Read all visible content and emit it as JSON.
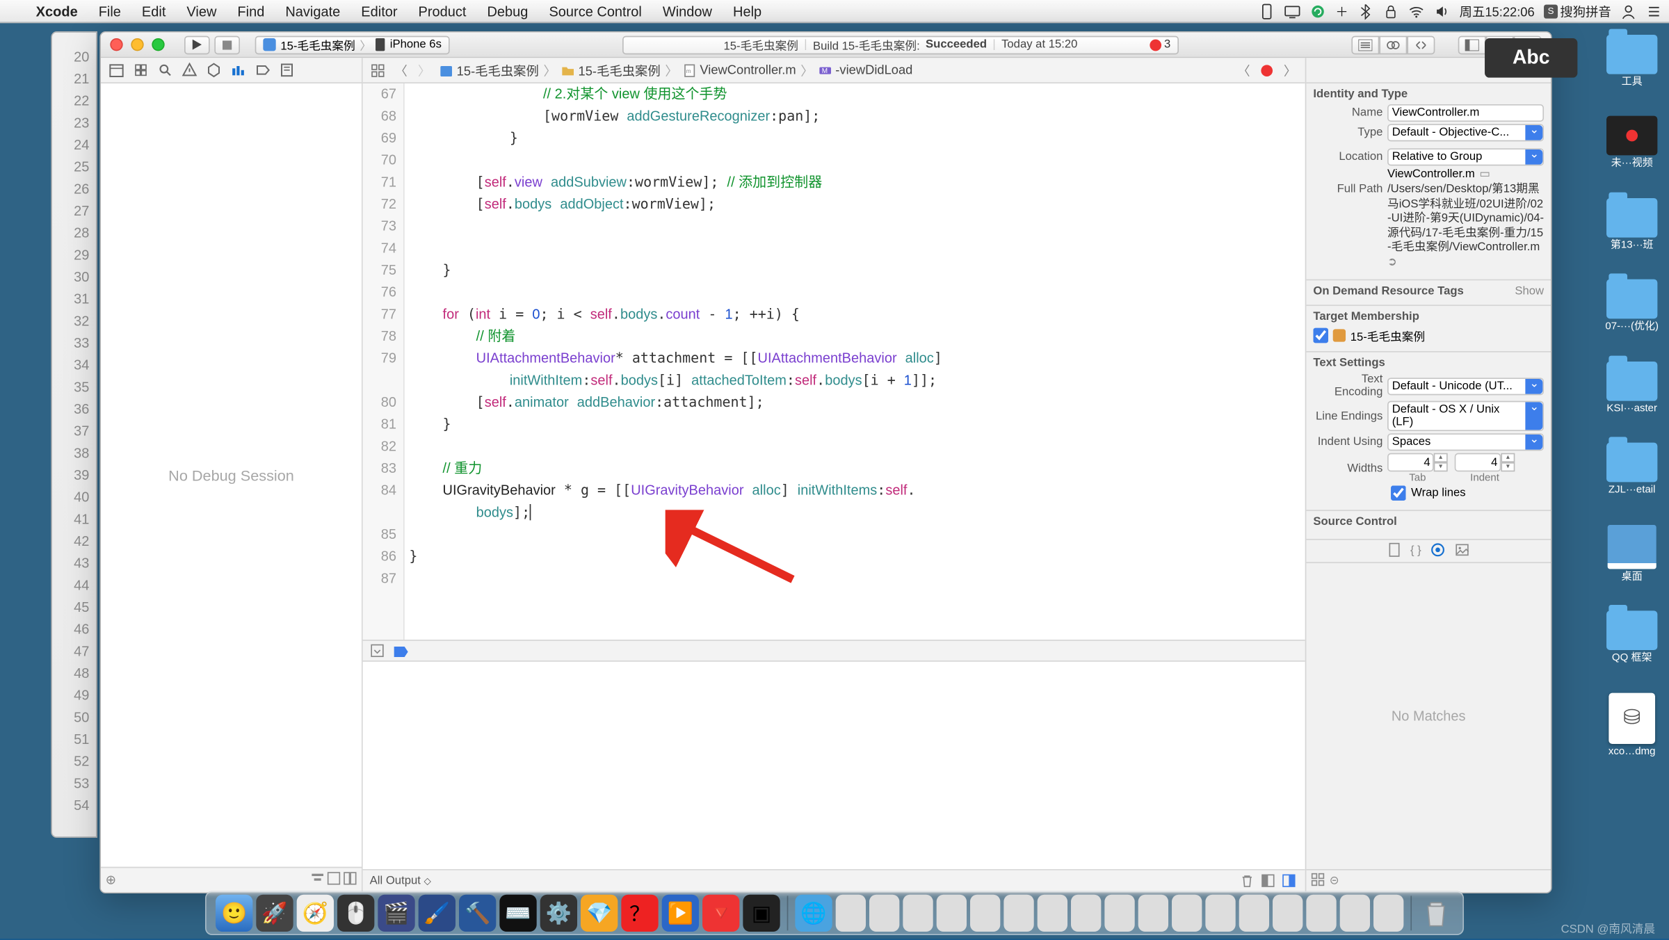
{
  "menubar": {
    "app": "Xcode",
    "items": [
      "File",
      "Edit",
      "View",
      "Find",
      "Navigate",
      "Editor",
      "Product",
      "Debug",
      "Source Control",
      "Window",
      "Help"
    ],
    "clock": "周五15:22:06",
    "ime": "搜狗拼音"
  },
  "toolbar": {
    "scheme_project": "15-毛毛虫案例",
    "scheme_device": "iPhone 6s",
    "activity_left": "15-毛毛虫案例",
    "activity_build": "Build 15-毛毛虫案例:",
    "activity_status": "Succeeded",
    "activity_time": "Today at 15:20",
    "error_count": "3"
  },
  "jumpbar": {
    "project": "15-毛毛虫案例",
    "folder": "15-毛毛虫案例",
    "file": "ViewController.m",
    "method": "-viewDidLoad"
  },
  "navigator": {
    "placeholder": "No Debug Session"
  },
  "gutter": {
    "behind": [
      "20",
      "21",
      "22",
      "23",
      "24",
      "25",
      "26",
      "27",
      "28",
      "29",
      "30",
      "31",
      "32",
      "33",
      "34",
      "35",
      "36",
      "37",
      "38",
      "39",
      "40",
      "41",
      "42",
      "43",
      "44",
      "45",
      "46",
      "47",
      "48",
      "49",
      "50",
      "51",
      "52",
      "53",
      "54"
    ],
    "front": [
      "67",
      "68",
      "69",
      "70",
      "71",
      "72",
      "73",
      "74",
      "75",
      "76",
      "77",
      "78",
      "79",
      "",
      "80",
      "81",
      "82",
      "83",
      "84",
      "",
      "85",
      "86",
      "87"
    ]
  },
  "output": {
    "filter": "All Output"
  },
  "inspector": {
    "identity_title": "Identity and Type",
    "name_label": "Name",
    "name_value": "ViewController.m",
    "type_label": "Type",
    "type_value": "Default - Objective-C...",
    "location_label": "Location",
    "location_value": "Relative to Group",
    "location_file": "ViewController.m",
    "fullpath_label": "Full Path",
    "fullpath_value": "/Users/sen/Desktop/第13期黑马iOS学科就业班/02UI进阶/02-UI进阶-第9天(UIDynamic)/04-源代码/17-毛毛虫案例-重力/15-毛毛虫案例/ViewController.m",
    "odr_title": "On Demand Resource Tags",
    "odr_show": "Show",
    "target_title": "Target Membership",
    "target_item": "15-毛毛虫案例",
    "text_title": "Text Settings",
    "enc_label": "Text Encoding",
    "enc_value": "Default - Unicode (UT...",
    "le_label": "Line Endings",
    "le_value": "Default - OS X / Unix (LF)",
    "indent_label": "Indent Using",
    "indent_value": "Spaces",
    "widths_label": "Widths",
    "tab_val": "4",
    "indent_val": "4",
    "tab_sub": "Tab",
    "indent_sub": "Indent",
    "wrap_label": "Wrap lines",
    "sc_title": "Source Control",
    "no_matches": "No Matches"
  },
  "desktop": {
    "items": [
      {
        "label": "工具",
        "type": "folder"
      },
      {
        "label": "未···视频",
        "type": "rec"
      },
      {
        "label": "第13···班",
        "type": "folder"
      },
      {
        "label": "07-···(优化)",
        "type": "folder"
      },
      {
        "label": "KSI···aster",
        "type": "folder"
      },
      {
        "label": "ZJL···etail",
        "type": "folder"
      },
      {
        "label": "桌面",
        "type": "book"
      },
      {
        "label": "QQ 框架",
        "type": "folder"
      },
      {
        "label": "xco…dmg",
        "type": "dmg"
      }
    ]
  },
  "abc_badge": "Abc",
  "watermark": "CSDN @南风清晨"
}
